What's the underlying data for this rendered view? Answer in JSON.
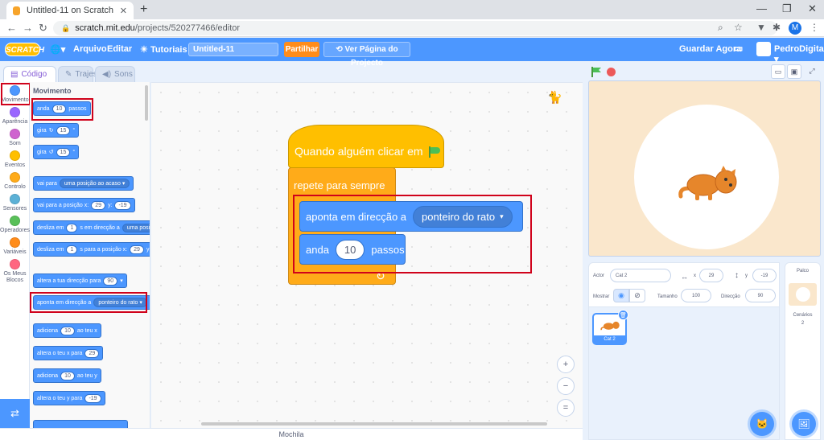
{
  "browser": {
    "tab_title": "Untitled-11 on Scratch",
    "tab_close": "✕",
    "new_tab": "+",
    "url_host": "scratch.mit.edu",
    "url_path": "/projects/520277466/editor",
    "profile_initial": "M"
  },
  "menubar": {
    "logo": "SCRATCH",
    "language_caret": "▾",
    "file": "Arquivo",
    "edit": "Editar",
    "tutorials": "Tutoriais",
    "project_title": "Untitled-11",
    "share": "Partilhar",
    "see_project": "Ver Página do Projecto",
    "save_now": "Guardar Agora",
    "username": "PedroDigitall",
    "user_caret": "▾"
  },
  "editor_tabs": {
    "code": "Código",
    "costumes": "Trajes",
    "sounds": "Sons"
  },
  "categories": [
    {
      "label": "Movimento",
      "color": "#4c97ff"
    },
    {
      "label": "Aparência",
      "color": "#9966ff"
    },
    {
      "label": "Som",
      "color": "#cf63cf"
    },
    {
      "label": "Eventos",
      "color": "#ffbf00"
    },
    {
      "label": "Controlo",
      "color": "#ffab19"
    },
    {
      "label": "Sensores",
      "color": "#5cb1d6"
    },
    {
      "label": "Operadores",
      "color": "#59c059"
    },
    {
      "label": "Variáveis",
      "color": "#ff8c1a"
    },
    {
      "label": "Os Meus Blocos",
      "color": "#ff6680"
    }
  ],
  "extensions_icon": "add-extension-icon",
  "palette": {
    "title": "Movimento",
    "move": {
      "pre": "anda",
      "val": "10",
      "post": "passos"
    },
    "turn_right": {
      "pre": "gira",
      "val": "15",
      "post": "°"
    },
    "turn_left": {
      "pre": "gira",
      "val": "15",
      "post": "°"
    },
    "goto": {
      "pre": "vai para",
      "dd": "uma posição ao acaso",
      "caret": "▾"
    },
    "goto_xy": {
      "pre": "vai para a posição x:",
      "x": "29",
      "mid": "y:",
      "y": "-19"
    },
    "glide_to": {
      "pre": "desliza em",
      "val": "1",
      "mid": "s em direcção a",
      "dd": "uma posiçã"
    },
    "glide_xy": {
      "pre": "desliza em",
      "val": "1",
      "mid": "s para a posição x:",
      "x": "29",
      "y_label": "y:"
    },
    "point_dir": {
      "pre": "altera a tua direcção para",
      "val": "90",
      "caret": "▾"
    },
    "point_towards": {
      "pre": "aponta em direcção a",
      "dd": "ponteiro do rato",
      "caret": "▾"
    },
    "change_x": {
      "pre": "adiciona",
      "val": "10",
      "post": "ao teu x"
    },
    "set_x": {
      "pre": "altera o teu x para",
      "val": "29"
    },
    "change_y": {
      "pre": "adiciona",
      "val": "10",
      "post": "ao teu y"
    },
    "set_y": {
      "pre": "altera o teu y para",
      "val": "-19"
    }
  },
  "script": {
    "hat": "Quando alguém clicar em",
    "forever": "repete para sempre",
    "point_towards": "aponta em direcção a",
    "point_dd": "ponteiro do rato",
    "caret": "▾",
    "move_pre": "anda",
    "move_val": "10",
    "move_post": "passos",
    "loop_arrow": "↻"
  },
  "zoom": {
    "in": "+",
    "out": "−",
    "reset": "="
  },
  "backpack": "Mochila",
  "sprite_info": {
    "actor_label": "Actor",
    "actor_value": "Cat 2",
    "x_arrow": "↔",
    "x_label": "x",
    "x_value": "29",
    "y_arrow": "↕",
    "y_label": "y",
    "y_value": "-19",
    "show_label": "Mostrar",
    "size_label": "Tamanho",
    "size_value": "100",
    "direction_label": "Direcção",
    "direction_value": "90"
  },
  "sprites": [
    {
      "name": "Cat 2"
    }
  ],
  "stage_panel": {
    "label": "Palco",
    "backdrops_label": "Cenários",
    "backdrops_count": "2"
  }
}
